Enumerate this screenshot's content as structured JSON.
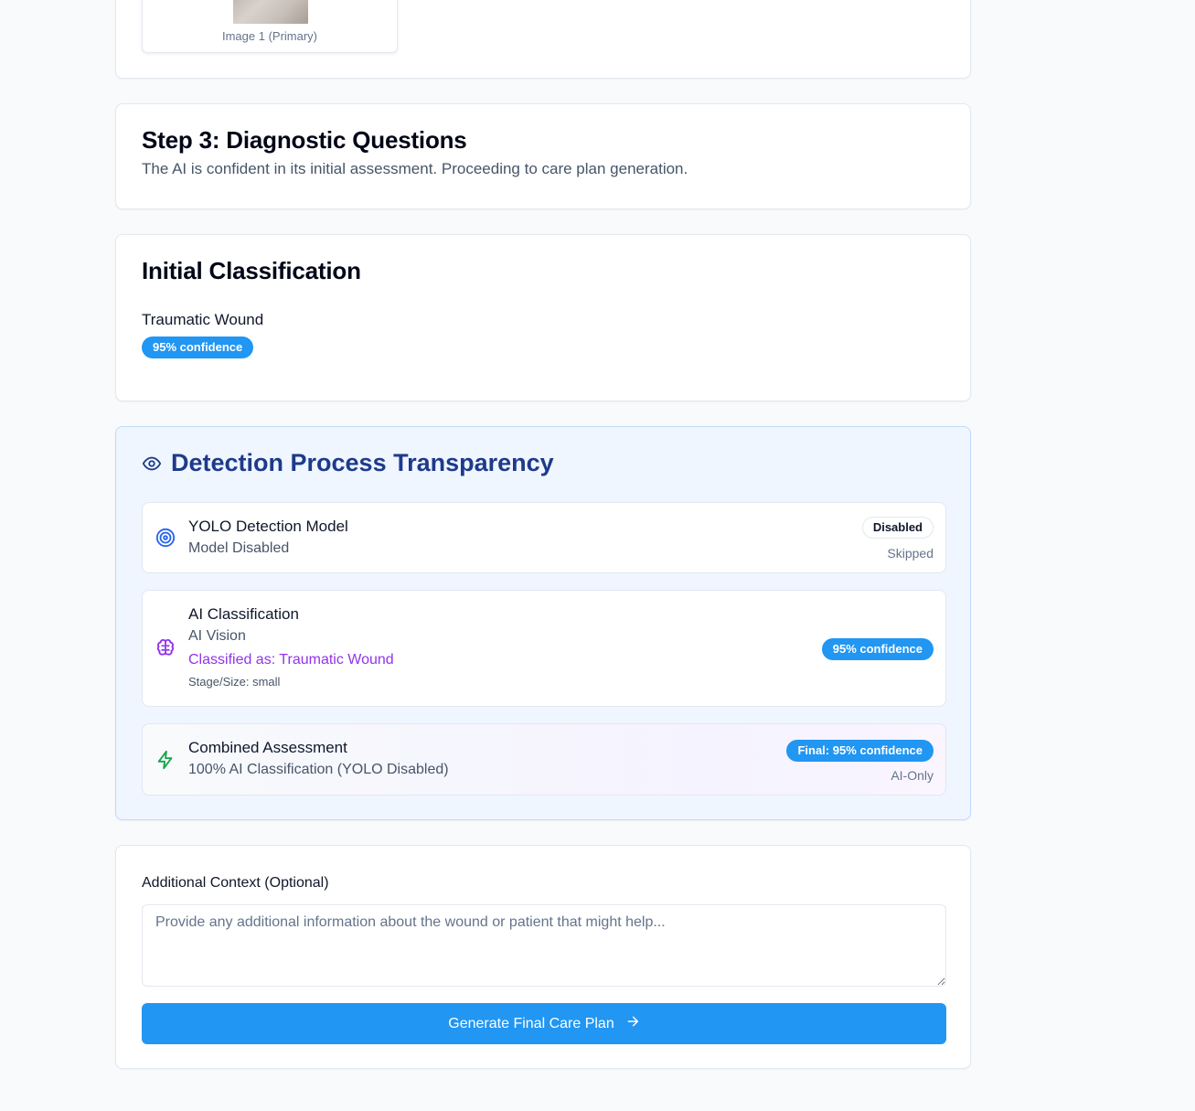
{
  "images": {
    "caption": "Image 1 (Primary)"
  },
  "step3": {
    "title": "Step 3: Diagnostic Questions",
    "description": "The AI is confident in its initial assessment. Proceeding to care plan generation."
  },
  "initial": {
    "title": "Initial Classification",
    "classification": "Traumatic Wound",
    "confidence": "95% confidence"
  },
  "transparency": {
    "title": "Detection Process Transparency",
    "yolo": {
      "title": "YOLO Detection Model",
      "subtitle": "Model Disabled",
      "badge": "Disabled",
      "note": "Skipped"
    },
    "ai": {
      "title": "AI Classification",
      "subtitle": "AI Vision",
      "classified": "Classified as: Traumatic Wound",
      "stage": "Stage/Size: small",
      "badge": "95% confidence"
    },
    "combined": {
      "title": "Combined Assessment",
      "subtitle": "100% AI Classification (YOLO Disabled)",
      "badge": "Final: 95% confidence",
      "note": "AI-Only"
    }
  },
  "context": {
    "label": "Additional Context (Optional)",
    "placeholder": "Provide any additional information about the wound or patient that might help...",
    "value": "",
    "button_label": "Generate Final Care Plan"
  },
  "colors": {
    "accent": "#2196f3",
    "transparency_title": "#1e3a8a",
    "purple": "#9333ea",
    "green": "#16a34a"
  },
  "icons": {
    "transparency": "eye-icon",
    "yolo": "target-icon",
    "ai": "brain-icon",
    "combined": "lightning-icon",
    "button": "arrow-right-icon"
  }
}
